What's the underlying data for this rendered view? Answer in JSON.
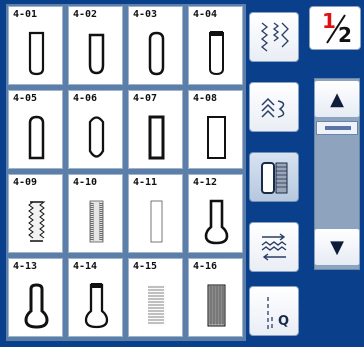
{
  "stitches": [
    {
      "code": "4-01",
      "shape": "rounded"
    },
    {
      "code": "4-02",
      "shape": "round-bottom"
    },
    {
      "code": "4-03",
      "shape": "rounded-both"
    },
    {
      "code": "4-04",
      "shape": "bartack-top"
    },
    {
      "code": "4-05",
      "shape": "rounded-top"
    },
    {
      "code": "4-06",
      "shape": "oval"
    },
    {
      "code": "4-07",
      "shape": "square-dense"
    },
    {
      "code": "4-08",
      "shape": "square"
    },
    {
      "code": "4-09",
      "shape": "zigzag"
    },
    {
      "code": "4-10",
      "shape": "fine-zigzag"
    },
    {
      "code": "4-11",
      "shape": "thin-outline"
    },
    {
      "code": "4-12",
      "shape": "keyhole"
    },
    {
      "code": "4-13",
      "shape": "keyhole-bold"
    },
    {
      "code": "4-14",
      "shape": "keyhole-tack"
    },
    {
      "code": "4-15",
      "shape": "bound"
    },
    {
      "code": "4-16",
      "shape": "patch"
    }
  ],
  "modes": [
    {
      "icon": "utility-stitch-icon",
      "selected": false
    },
    {
      "icon": "decorative-stitch-icon",
      "selected": false
    },
    {
      "icon": "buttonhole-icon",
      "selected": true
    },
    {
      "icon": "quilt-stitch-icon",
      "selected": false
    },
    {
      "icon": "q-quilt-icon",
      "selected": false,
      "label": "Q"
    }
  ],
  "pager": {
    "current": "1",
    "total": "2",
    "current_color": "#e01010"
  },
  "scroll": {
    "up_icon": "arrow-up-icon",
    "down_icon": "arrow-down-icon"
  }
}
